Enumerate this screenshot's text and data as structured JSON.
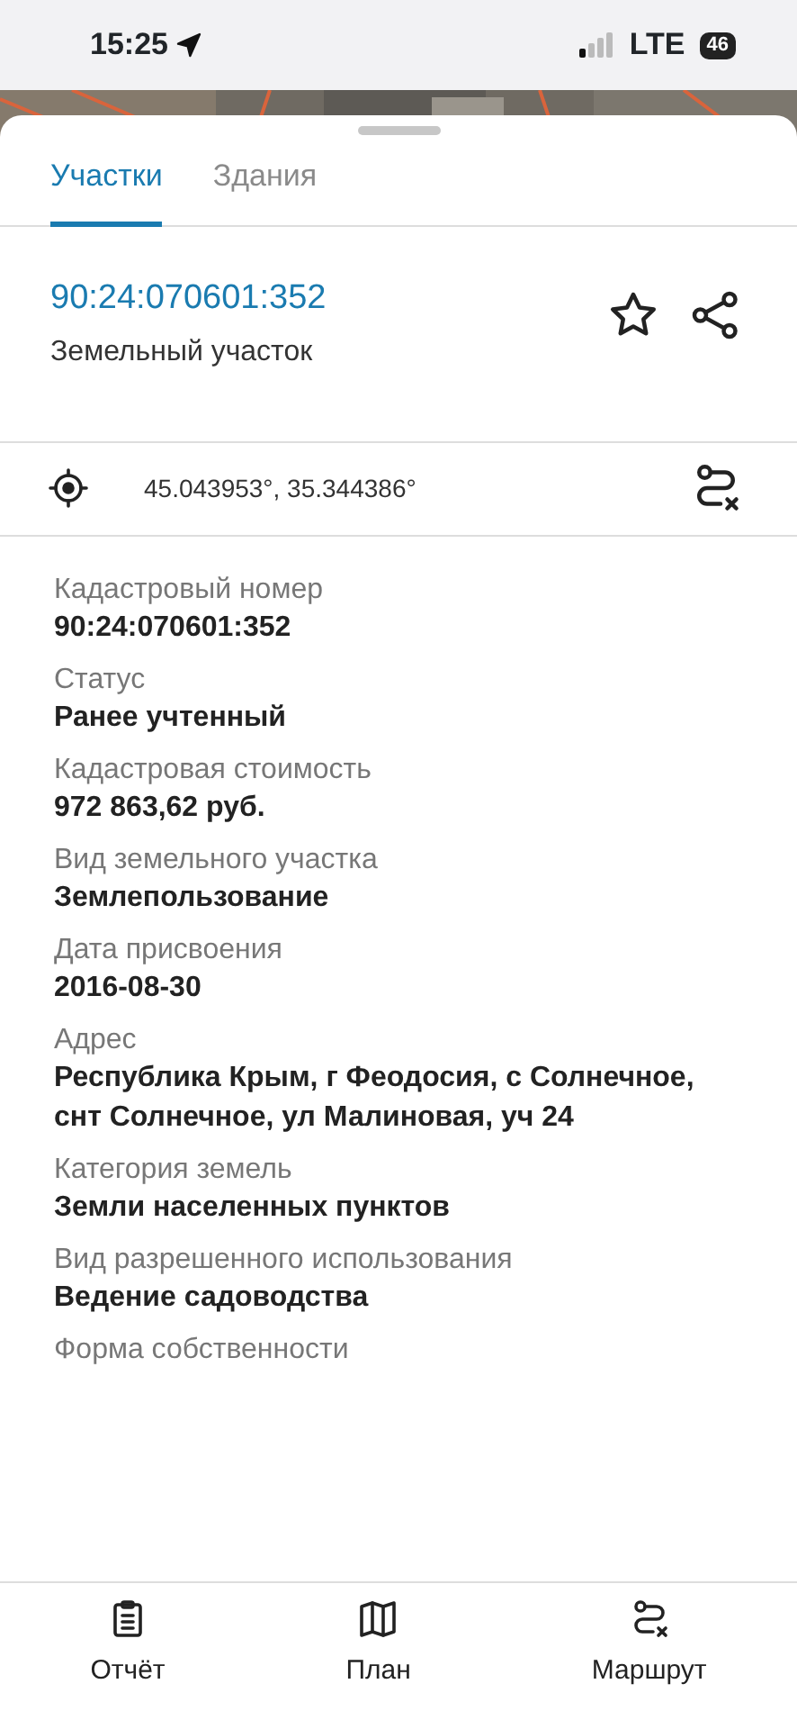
{
  "status_bar": {
    "time": "15:25",
    "network": "LTE",
    "battery": "46"
  },
  "tabs": [
    {
      "label": "Участки",
      "selected": true
    },
    {
      "label": "Здания",
      "selected": false
    }
  ],
  "header": {
    "number": "90:24:070601:352",
    "type": "Земельный участок",
    "favorite": false
  },
  "coordinates": "45.043953°, 35.344386°",
  "fields": [
    {
      "label": "Кадастровый номер",
      "value": "90:24:070601:352"
    },
    {
      "label": "Статус",
      "value": "Ранее учтенный"
    },
    {
      "label": "Кадастровая стоимость",
      "value": "972 863,62 руб."
    },
    {
      "label": "Вид земельного участка",
      "value": "Землепользование"
    },
    {
      "label": "Дата присвоения",
      "value": "2016-08-30"
    },
    {
      "label": "Адрес",
      "value": "Республика Крым, г Феодосия, с Солнечное, снт Солнечное, ул Малиновая, уч 24"
    },
    {
      "label": "Категория земель",
      "value": "Земли населенных пунктов"
    },
    {
      "label": "Вид разрешенного использования",
      "value": "Ведение садоводства"
    },
    {
      "label": "Форма собственности"
    }
  ],
  "bottom_nav": [
    {
      "kind": "report",
      "label": "Отчёт"
    },
    {
      "kind": "plan",
      "label": "План"
    },
    {
      "kind": "route",
      "label": "Маршрут"
    }
  ]
}
